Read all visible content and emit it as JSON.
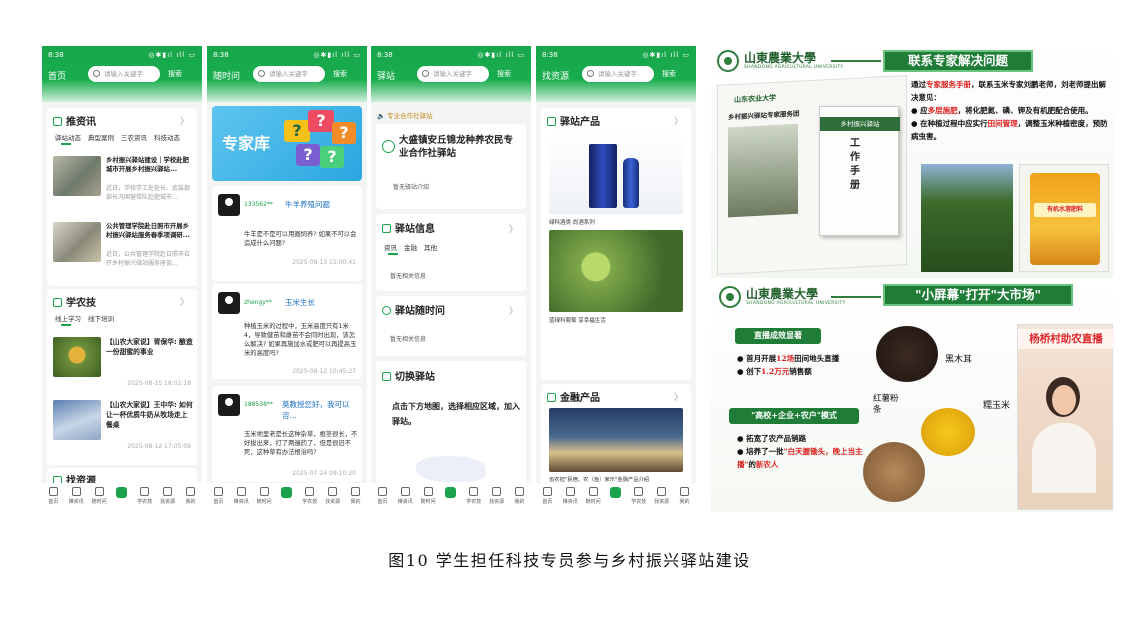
{
  "status_time": "8:38",
  "search_placeholder": "请输入关键字",
  "search_btn": "搜索",
  "nav_items": [
    "首页",
    "推资讯",
    "随时问",
    "",
    "学农技",
    "找资源",
    "我的"
  ],
  "phone1": {
    "title": "首页",
    "news_section": "推资讯",
    "news_tabs": [
      "驿站动态",
      "典型案例",
      "三农资讯",
      "科技动态"
    ],
    "news": [
      {
        "title": "乡村振兴驿站建设｜学校赴肥城市开展乡村振兴驿站...",
        "snippet": "近日，学校学工处处长、武装部部长冯国营带队赴肥城市..."
      },
      {
        "title": "公共管理学院赴日照市开展乡村振兴驿站服务春季项调研...",
        "snippet": "近日，公共管理学院赴日照市召开乡村振兴驿站服务座谈..."
      }
    ],
    "tech_section": "学农技",
    "tech_tabs": [
      "线上学习",
      "线下培训"
    ],
    "videos": [
      {
        "title": "【山农大家说】胥保华: 酿造一份甜蜜的事业",
        "time": "2025-08-15 18:02:18"
      },
      {
        "title": "【山农大家说】王中华: 如何让一杯优质牛奶从牧场走上餐桌",
        "time": "2025-08-12 17:05:09"
      }
    ],
    "res_section": "找资源"
  },
  "phone2": {
    "title": "随时问",
    "banner": "专家库",
    "posts": [
      {
        "id": "133562**",
        "title": "牛羊养殖问题",
        "q": "牛羊是不是可以用圈饲养? 如果不可以会造成什么问题?",
        "time": "2025-08-13 15:00:41"
      },
      {
        "id": "zhengy**",
        "title": "玉米生长",
        "q": "种植玉米的过程中，玉米高度只有1米4，导致健苗和雌苗不会同时出现，该怎么解决? 如果再施加水或肥可以再提高玉米的高度吗?",
        "time": "2025-08-12 10:45:27"
      },
      {
        "id": "188538**",
        "title": "莫教授您好，我可以咨...",
        "q": "玉米地里老是长这种杂草，根茎很长，不好拔出来，打了两遍药了，但是很旧不死，这种草有办法根治吗?",
        "time": "2025-07-24 09:10:20"
      }
    ]
  },
  "phone3": {
    "title": "驿站",
    "notice": "专业合作社驿站",
    "station_name": "大盛镇安丘锦龙种养农民专业合作社驿站",
    "station_intro": "暂无驿站介绍",
    "info_section": "驿站信息",
    "info_tabs": [
      "资讯",
      "金融",
      "其他"
    ],
    "info_empty": "暂无相关信息",
    "ask_section": "驿站随时问",
    "ask_empty": "暂无相关信息",
    "switch_section": "切换驿站",
    "switch_text": "点击下方地图，选择相应区域，加入驿站。"
  },
  "phone4": {
    "title": "找资源",
    "products_section": "驿站产品",
    "product1_caption": "绿科酒类 尚酒系列",
    "product2_caption": "蓝绿科葡萄 享幸福生活",
    "finance_section": "金融产品",
    "finance_caption": "省农担\"民宿、农（渔）家乐\"金融产品介绍"
  },
  "slide1": {
    "university": "山東農業大學",
    "university_en": "SHANDONG AGRICULTURAL UNIVERSITY",
    "heading": "联系专家解决问题",
    "manual_univ": "山东农业大学",
    "manual_line": "乡村振兴驿站专家服务团",
    "manual_title": "乡村振兴驿站",
    "manual_big": "工作手册",
    "bullet1_pre": "通过",
    "bullet1_red": "专家服务手册",
    "bullet1_post": "，联系玉米专家刘鹏老师，刘老师提出解决意见：",
    "bullet2_pre": "应",
    "bullet2_red": "多层施肥",
    "bullet2_post": "，将化肥氮、磷、钾及有机肥配合使用。",
    "bullet3_pre": "在种植过程中应实行",
    "bullet3_red": "田间管理",
    "bullet3_post": "，调整玉米种植密度，预防病虫害。",
    "bucket_label": "有机水溶肥料"
  },
  "slide2": {
    "university": "山東農業大學",
    "university_en": "SHANDONG AGRICULTURAL UNIVERSITY",
    "heading": "\"小屏幕\"打开\"大市场\"",
    "pill1": "直播成效显著",
    "b1_pre": "首月开展",
    "b1_red": "12场",
    "b1_post": "田间地头直播",
    "b2_pre": "创下",
    "b2_red": "1.2万元",
    "b2_post": "销售额",
    "pill2": "\"高校+企业+农户\"模式",
    "b3": "拓宽了农产品销路",
    "b4_pre": "培养了一批",
    "b4_red": "\"白天握锄头，晚上当主播\"",
    "b4_post": "的",
    "b4_red2": "新农人",
    "label_fungus": "黑木耳",
    "label_powder": "红薯粉条",
    "label_corn": "糯玉米",
    "live_banner": "杨桥村助农直播"
  },
  "caption": "图10 学生担任科技专员参与乡村振兴驿站建设"
}
